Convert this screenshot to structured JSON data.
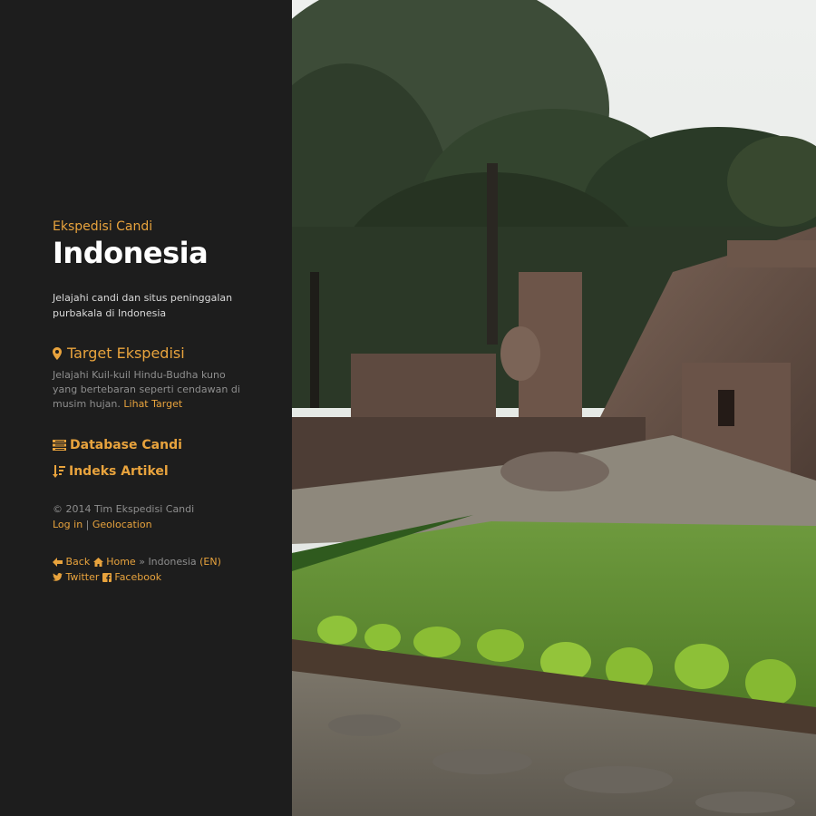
{
  "sidebar": {
    "subtitle": "Ekspedisi Candi",
    "title": "Indonesia",
    "tagline": "Jelajahi candi dan situs peninggalan purbakala di Indonesia",
    "target": {
      "icon": "map-marker-icon",
      "title": "Target Ekspedisi",
      "description": "Jelajahi Kuil-kuil Hindu-Budha kuno yang bertebaran seperti cendawan di musim hujan.",
      "link": "Lihat Target"
    },
    "nav": [
      {
        "icon": "database-icon",
        "label": "Database Candi"
      },
      {
        "icon": "sort-icon",
        "label": "Indeks Artikel"
      }
    ],
    "footer": {
      "copyright": "© 2014 Tim Ekspedisi Candi",
      "login": "Log in",
      "separator": "|",
      "geolocation": "Geolocation"
    },
    "bottom": {
      "back": "Back",
      "home": "Home",
      "chevrons": "»",
      "current": "Indonesia",
      "lang": "(EN)",
      "twitter": "Twitter",
      "facebook": "Facebook"
    }
  },
  "colors": {
    "accent": "#e8a33d",
    "background": "#1d1d1d",
    "text": "#e9e9e9",
    "muted": "#8e8e8e"
  }
}
